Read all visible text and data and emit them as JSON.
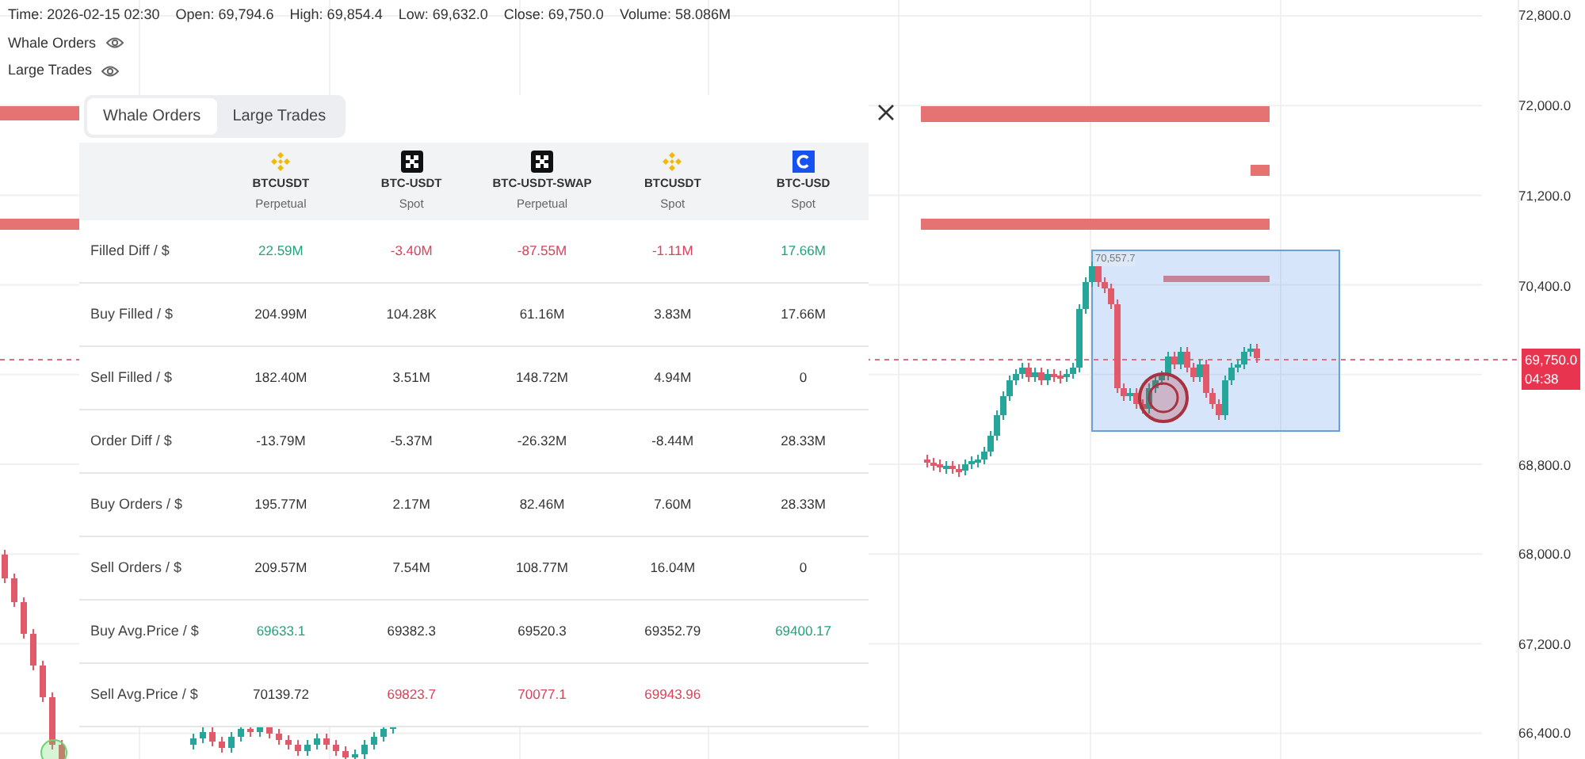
{
  "legend": {
    "fields": [
      "Time: 2026-02-15 02:30",
      "Open: 69,794.6",
      "High: 69,854.4",
      "Low: 69,632.0",
      "Close: 69,750.0",
      "Volume: 58.086M"
    ],
    "layers": [
      {
        "label": "Whale Orders",
        "visible": true
      },
      {
        "label": "Large Trades",
        "visible": true
      }
    ]
  },
  "price_axis": {
    "labels": [
      "72,800.0",
      "72,000.0",
      "71,200.0",
      "70,400.0",
      "68,800.0",
      "68,000.0",
      "67,200.0",
      "66,400.0"
    ],
    "last_price": "69,750.0",
    "countdown": "04:38"
  },
  "high_marker": "70,557.7",
  "panel": {
    "tabs": [
      {
        "label": "Whale Orders",
        "selected": true
      },
      {
        "label": "Large Trades",
        "selected": false
      }
    ],
    "columns": [
      {
        "symbol": "BTCUSDT",
        "market": "Perpetual",
        "kind": "diamond"
      },
      {
        "symbol": "BTC-USDT",
        "market": "Spot",
        "kind": "checker"
      },
      {
        "symbol": "BTC-USDT-SWAP",
        "market": "Perpetual",
        "kind": "checker"
      },
      {
        "symbol": "BTCUSDT",
        "market": "Spot",
        "kind": "diamond"
      },
      {
        "symbol": "BTC-USD",
        "market": "Spot",
        "kind": "arc"
      }
    ],
    "rows": [
      {
        "label": "Filled Diff / $",
        "cells": [
          {
            "text": "22.59M",
            "color": "#21a27a"
          },
          {
            "text": "-3.40M",
            "color": "#d9425a"
          },
          {
            "text": "-87.55M",
            "color": "#d9425a"
          },
          {
            "text": "-1.11M",
            "color": "#d9425a"
          },
          {
            "text": "17.66M",
            "color": "#21a27a"
          }
        ]
      },
      {
        "label": "Buy Filled / $",
        "cells": [
          {
            "text": "204.99M"
          },
          {
            "text": "104.28K"
          },
          {
            "text": "61.16M"
          },
          {
            "text": "3.83M"
          },
          {
            "text": "17.66M"
          }
        ]
      },
      {
        "label": "Sell Filled / $",
        "cells": [
          {
            "text": "182.40M"
          },
          {
            "text": "3.51M"
          },
          {
            "text": "148.72M"
          },
          {
            "text": "4.94M"
          },
          {
            "text": "0"
          }
        ]
      },
      {
        "label": "Order Diff / $",
        "cells": [
          {
            "text": "-13.79M"
          },
          {
            "text": "-5.37M"
          },
          {
            "text": "-26.32M"
          },
          {
            "text": "-8.44M"
          },
          {
            "text": "28.33M"
          }
        ]
      },
      {
        "label": "Buy Orders / $",
        "cells": [
          {
            "text": "195.77M"
          },
          {
            "text": "2.17M"
          },
          {
            "text": "82.46M"
          },
          {
            "text": "7.60M"
          },
          {
            "text": "28.33M"
          }
        ]
      },
      {
        "label": "Sell Orders / $",
        "cells": [
          {
            "text": "209.57M"
          },
          {
            "text": "7.54M"
          },
          {
            "text": "108.77M"
          },
          {
            "text": "16.04M"
          },
          {
            "text": "0"
          }
        ]
      },
      {
        "label": "Buy Avg.Price / $",
        "cells": [
          {
            "text": "69633.1",
            "color": "#21a27a"
          },
          {
            "text": "69382.3"
          },
          {
            "text": "69520.3"
          },
          {
            "text": "69352.79"
          },
          {
            "text": "69400.17",
            "color": "#21a27a"
          }
        ]
      },
      {
        "label": "Sell Avg.Price / $",
        "cells": [
          {
            "text": "70139.72"
          },
          {
            "text": "69823.7",
            "color": "#d9425a"
          },
          {
            "text": "70077.1",
            "color": "#d9425a"
          },
          {
            "text": "69943.96",
            "color": "#d9425a"
          }
        ]
      }
    ]
  }
}
